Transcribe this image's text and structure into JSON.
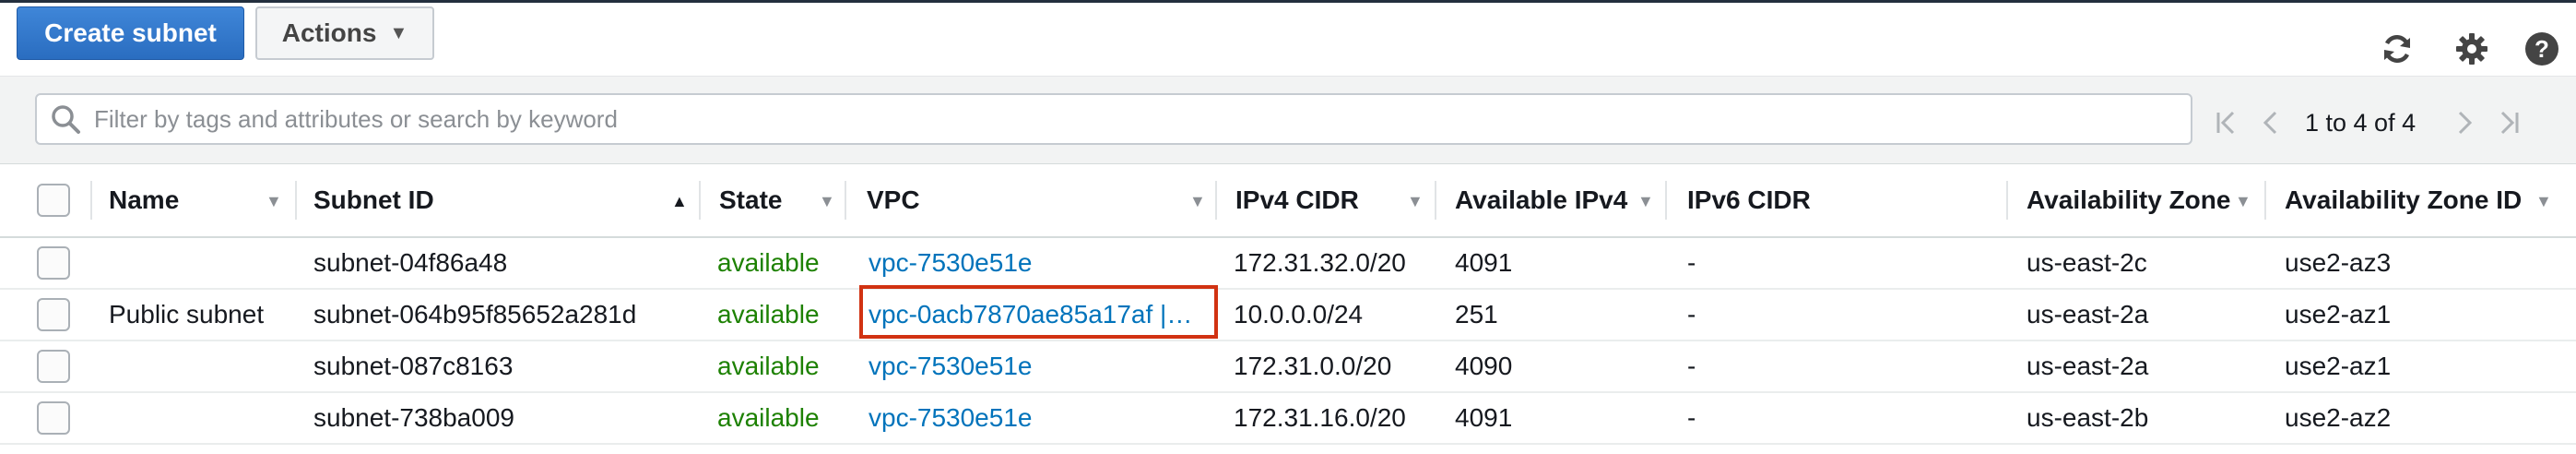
{
  "toolbar": {
    "create_label": "Create subnet",
    "actions_label": "Actions",
    "icons": [
      "refresh-icon",
      "gear-icon",
      "help-icon"
    ]
  },
  "filter": {
    "placeholder": "Filter by tags and attributes or search by keyword",
    "value": ""
  },
  "pagination": {
    "text": "1 to 4 of 4"
  },
  "table": {
    "columns": [
      "Name",
      "Subnet ID",
      "State",
      "VPC",
      "IPv4 CIDR",
      "Available IPv4",
      "IPv6 CIDR",
      "Availability Zone",
      "Availability Zone ID"
    ],
    "rows": [
      {
        "name": "",
        "subnet_id": "subnet-04f86a48",
        "state": "available",
        "vpc": "vpc-7530e51e",
        "ipv4_cidr": "172.31.32.0/20",
        "available_ipv4": "4091",
        "ipv6_cidr": "-",
        "az": "us-east-2c",
        "az_id": "use2-az3"
      },
      {
        "name": "Public subnet",
        "subnet_id": "subnet-064b95f85652a281d",
        "state": "available",
        "vpc": "vpc-0acb7870ae85a17af |…",
        "ipv4_cidr": "10.0.0.0/24",
        "available_ipv4": "251",
        "ipv6_cidr": "-",
        "az": "us-east-2a",
        "az_id": "use2-az1"
      },
      {
        "name": "",
        "subnet_id": "subnet-087c8163",
        "state": "available",
        "vpc": "vpc-7530e51e",
        "ipv4_cidr": "172.31.0.0/20",
        "available_ipv4": "4090",
        "ipv6_cidr": "-",
        "az": "us-east-2a",
        "az_id": "use2-az1"
      },
      {
        "name": "",
        "subnet_id": "subnet-738ba009",
        "state": "available",
        "vpc": "vpc-7530e51e",
        "ipv4_cidr": "172.31.16.0/20",
        "available_ipv4": "4091",
        "ipv6_cidr": "-",
        "az": "us-east-2b",
        "az_id": "use2-az2"
      }
    ]
  },
  "colors": {
    "primary": "#2a6dc0",
    "state_available": "#1d8102",
    "link": "#0073bb",
    "highlight": "#d13212"
  }
}
